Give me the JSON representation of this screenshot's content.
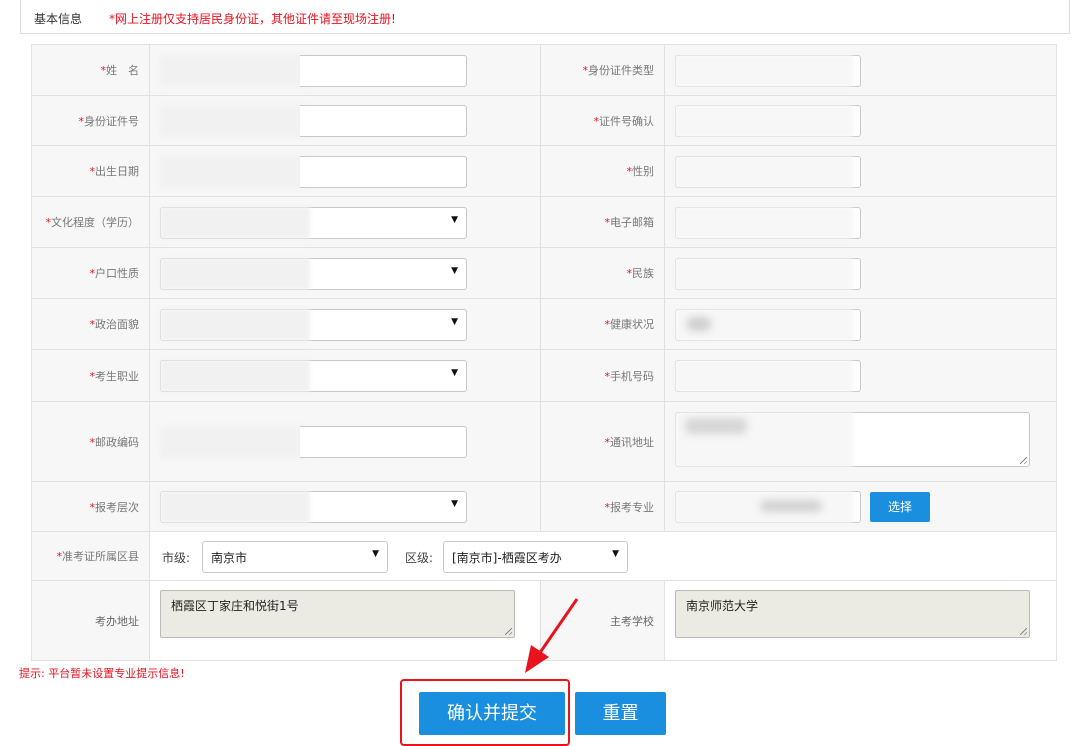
{
  "header": {
    "title": "基本信息",
    "notice": "*网上注册仅支持居民身份证，其他证件请至现场注册!"
  },
  "req_mark": "*",
  "labels": {
    "name": "姓　名",
    "id_type": "身份证件类型",
    "id_number": "身份证件号",
    "id_confirm": "证件号确认",
    "birth": "出生日期",
    "gender": "性别",
    "education": "文化程度（学历）",
    "email": "电子邮箱",
    "hukou": "户口性质",
    "ethnicity": "民族",
    "politics": "政治面貌",
    "health": "健康状况",
    "occupation": "考生职业",
    "phone": "手机号码",
    "postcode": "邮政编码",
    "address": "通讯地址",
    "level": "报考层次",
    "major": "报考专业",
    "district": "准考证所属区县",
    "office_address": "考办地址",
    "school": "主考学校"
  },
  "district": {
    "city_label": "市级:",
    "city_value": "南京市",
    "area_label": "区级:",
    "area_value": "[南京市]-栖霞区考办"
  },
  "office_address_value": "栖霞区丁家庄和悦街1号",
  "school_value": "南京师范大学",
  "choose_button": "选择",
  "tip": "提示:  平台暂未设置专业提示信息!",
  "buttons": {
    "submit": "确认并提交",
    "reset": "重置"
  },
  "colors": {
    "accent": "#1a8fdf",
    "warning": "#e8131d",
    "readonly_bg": "#ebebe4"
  }
}
